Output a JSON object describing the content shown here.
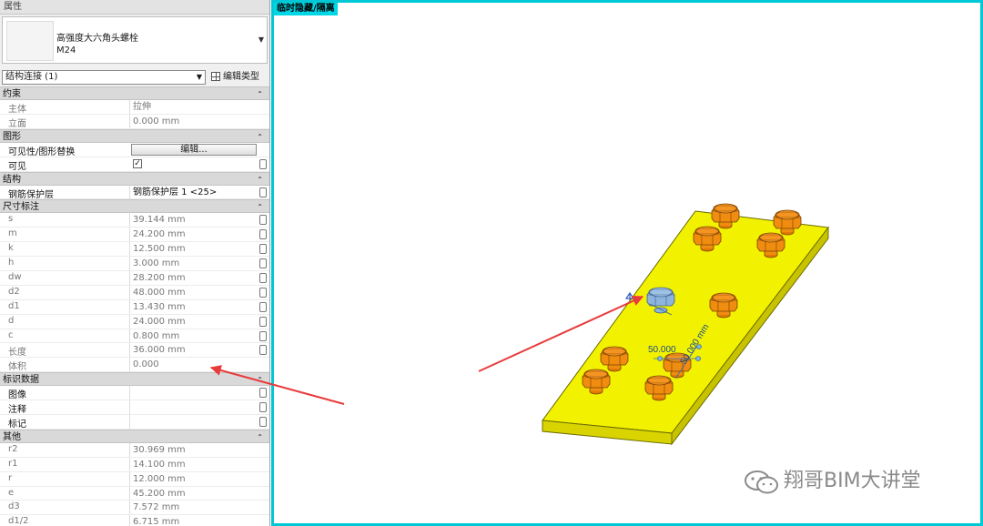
{
  "palette": {
    "title": "属性",
    "type_selector": {
      "family": "高强度大六角头螺栓",
      "type": "M24"
    },
    "filter": {
      "value": "结构连接 (1)",
      "edit_type_label": "编辑类型"
    }
  },
  "sections": {
    "constraints": {
      "title": "约束",
      "host_label": "主体",
      "host_value": "拉伸",
      "elev_label": "立面",
      "elev_value": "0.000 mm"
    },
    "graphics": {
      "title": "图形",
      "vg_label": "可见性/图形替换",
      "vg_button": "编辑...",
      "visible_label": "可见",
      "visible_check": "✓"
    },
    "structure": {
      "title": "结构",
      "cover_label": "钢筋保护层",
      "cover_value": "钢筋保护层 1 <25>"
    },
    "dimensions": {
      "title": "尺寸标注",
      "rows": [
        {
          "k": "s",
          "v": "39.144 mm"
        },
        {
          "k": "m",
          "v": "24.200 mm"
        },
        {
          "k": "k",
          "v": "12.500 mm"
        },
        {
          "k": "h",
          "v": "3.000 mm"
        },
        {
          "k": "dw",
          "v": "28.200 mm"
        },
        {
          "k": "d2",
          "v": "48.000 mm"
        },
        {
          "k": "d1",
          "v": "13.430 mm"
        },
        {
          "k": "d",
          "v": "24.000 mm"
        },
        {
          "k": "c",
          "v": "0.800 mm"
        },
        {
          "k": "长度",
          "v": "36.000 mm"
        },
        {
          "k": "体积",
          "v": "0.000"
        }
      ]
    },
    "identity": {
      "title": "标识数据",
      "image_label": "图像",
      "comments_label": "注释",
      "mark_label": "标记"
    },
    "other": {
      "title": "其他",
      "rows": [
        {
          "k": "r2",
          "v": "30.969 mm"
        },
        {
          "k": "r1",
          "v": "14.100 mm"
        },
        {
          "k": "r",
          "v": "12.000 mm"
        },
        {
          "k": "e",
          "v": "45.200 mm"
        },
        {
          "k": "d3",
          "v": "7.572 mm"
        },
        {
          "k": "d1/2",
          "v": "6.715 mm"
        }
      ]
    },
    "collapse_glyph": "⌃"
  },
  "view": {
    "label": "临时隐藏/隔离",
    "dim_text_1": "50.000",
    "dim_text_2": "50.000 mm"
  },
  "colors": {
    "plate": "#f2f200",
    "bolt": "#f08c10",
    "selected_bolt": "#8cb4dc",
    "arrow": "#e83c3c",
    "view_border": "#00c8d6"
  },
  "watermark": {
    "icon": "wechat-icon",
    "text": "翔哥BIM大讲堂"
  }
}
